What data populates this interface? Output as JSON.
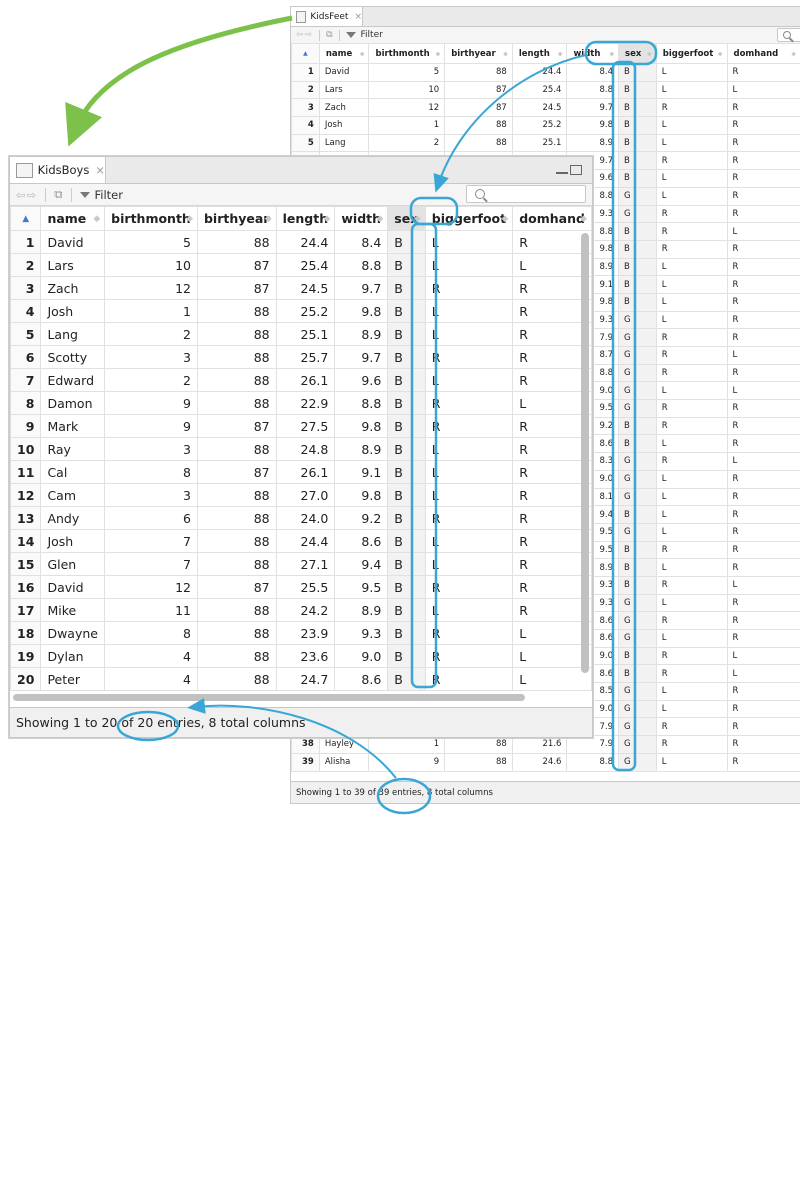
{
  "back_window": {
    "tab_title": "KidsFeet",
    "close_glyph": "×",
    "filter_label": "Filter",
    "columns": [
      "name",
      "birthmonth",
      "birthyear",
      "length",
      "width",
      "sex",
      "biggerfoot",
      "domhand"
    ],
    "rows": [
      [
        "1",
        "David",
        "5",
        "88",
        "24.4",
        "8.4",
        "B",
        "L",
        "R"
      ],
      [
        "2",
        "Lars",
        "10",
        "87",
        "25.4",
        "8.8",
        "B",
        "L",
        "L"
      ],
      [
        "3",
        "Zach",
        "12",
        "87",
        "24.5",
        "9.7",
        "B",
        "R",
        "R"
      ],
      [
        "4",
        "Josh",
        "1",
        "88",
        "25.2",
        "9.8",
        "B",
        "L",
        "R"
      ],
      [
        "5",
        "Lang",
        "2",
        "88",
        "25.1",
        "8.9",
        "B",
        "L",
        "R"
      ]
    ],
    "visible_right_rows": [
      [
        "9.7",
        "B",
        "R",
        "R"
      ],
      [
        "9.6",
        "B",
        "L",
        "R"
      ],
      [
        "8.8",
        "G",
        "L",
        "R"
      ],
      [
        "9.3",
        "G",
        "R",
        "R"
      ],
      [
        "8.8",
        "B",
        "R",
        "L"
      ],
      [
        "9.8",
        "B",
        "R",
        "R"
      ],
      [
        "8.9",
        "B",
        "L",
        "R"
      ],
      [
        "9.1",
        "B",
        "L",
        "R"
      ],
      [
        "9.8",
        "B",
        "L",
        "R"
      ],
      [
        "9.3",
        "G",
        "L",
        "R"
      ],
      [
        "7.9",
        "G",
        "R",
        "R"
      ],
      [
        "8.7",
        "G",
        "R",
        "L"
      ],
      [
        "8.8",
        "G",
        "R",
        "R"
      ],
      [
        "9.0",
        "G",
        "L",
        "L"
      ],
      [
        "9.5",
        "G",
        "R",
        "R"
      ],
      [
        "9.2",
        "B",
        "R",
        "R"
      ],
      [
        "8.6",
        "B",
        "L",
        "R"
      ],
      [
        "8.3",
        "G",
        "R",
        "L"
      ],
      [
        "9.0",
        "G",
        "L",
        "R"
      ],
      [
        "8.1",
        "G",
        "L",
        "R"
      ],
      [
        "9.4",
        "B",
        "L",
        "R"
      ],
      [
        "9.5",
        "G",
        "L",
        "R"
      ],
      [
        "9.5",
        "B",
        "R",
        "R"
      ],
      [
        "8.9",
        "B",
        "L",
        "R"
      ],
      [
        "9.3",
        "B",
        "R",
        "L"
      ],
      [
        "9.3",
        "G",
        "L",
        "R"
      ],
      [
        "8.6",
        "G",
        "R",
        "R"
      ],
      [
        "8.6",
        "G",
        "L",
        "R"
      ],
      [
        "9.0",
        "B",
        "R",
        "L"
      ],
      [
        "8.6",
        "B",
        "R",
        "L"
      ],
      [
        "8.5",
        "G",
        "L",
        "R"
      ],
      [
        "9.0",
        "G",
        "L",
        "R"
      ],
      [
        "7.9",
        "G",
        "R",
        "R"
      ]
    ],
    "partial_row_38": [
      "38",
      "Hayley",
      "1",
      "88",
      "21.6",
      "7.9",
      "G",
      "R",
      "R"
    ],
    "row_39": [
      "39",
      "Alisha",
      "9",
      "88",
      "24.6",
      "8.8",
      "G",
      "L",
      "R"
    ],
    "footer": "Showing 1 to 39 of 39 entries, 8 total columns"
  },
  "front_window": {
    "tab_title": "KidsBoys",
    "close_glyph": "×",
    "filter_label": "Filter",
    "columns": [
      "name",
      "birthmonth",
      "birthyear",
      "length",
      "width",
      "sex",
      "biggerfoot",
      "domhand"
    ],
    "rows": [
      [
        "1",
        "David",
        "5",
        "88",
        "24.4",
        "8.4",
        "B",
        "L",
        "R"
      ],
      [
        "2",
        "Lars",
        "10",
        "87",
        "25.4",
        "8.8",
        "B",
        "L",
        "L"
      ],
      [
        "3",
        "Zach",
        "12",
        "87",
        "24.5",
        "9.7",
        "B",
        "R",
        "R"
      ],
      [
        "4",
        "Josh",
        "1",
        "88",
        "25.2",
        "9.8",
        "B",
        "L",
        "R"
      ],
      [
        "5",
        "Lang",
        "2",
        "88",
        "25.1",
        "8.9",
        "B",
        "L",
        "R"
      ],
      [
        "6",
        "Scotty",
        "3",
        "88",
        "25.7",
        "9.7",
        "B",
        "R",
        "R"
      ],
      [
        "7",
        "Edward",
        "2",
        "88",
        "26.1",
        "9.6",
        "B",
        "L",
        "R"
      ],
      [
        "8",
        "Damon",
        "9",
        "88",
        "22.9",
        "8.8",
        "B",
        "R",
        "L"
      ],
      [
        "9",
        "Mark",
        "9",
        "87",
        "27.5",
        "9.8",
        "B",
        "R",
        "R"
      ],
      [
        "10",
        "Ray",
        "3",
        "88",
        "24.8",
        "8.9",
        "B",
        "L",
        "R"
      ],
      [
        "11",
        "Cal",
        "8",
        "87",
        "26.1",
        "9.1",
        "B",
        "L",
        "R"
      ],
      [
        "12",
        "Cam",
        "3",
        "88",
        "27.0",
        "9.8",
        "B",
        "L",
        "R"
      ],
      [
        "13",
        "Andy",
        "6",
        "88",
        "24.0",
        "9.2",
        "B",
        "R",
        "R"
      ],
      [
        "14",
        "Josh",
        "7",
        "88",
        "24.4",
        "8.6",
        "B",
        "L",
        "R"
      ],
      [
        "15",
        "Glen",
        "7",
        "88",
        "27.1",
        "9.4",
        "B",
        "L",
        "R"
      ],
      [
        "16",
        "David",
        "12",
        "87",
        "25.5",
        "9.5",
        "B",
        "R",
        "R"
      ],
      [
        "17",
        "Mike",
        "11",
        "88",
        "24.2",
        "8.9",
        "B",
        "L",
        "R"
      ],
      [
        "18",
        "Dwayne",
        "8",
        "88",
        "23.9",
        "9.3",
        "B",
        "R",
        "L"
      ],
      [
        "19",
        "Dylan",
        "4",
        "88",
        "23.6",
        "9.0",
        "B",
        "R",
        "L"
      ],
      [
        "20",
        "Peter",
        "4",
        "88",
        "24.7",
        "8.6",
        "B",
        "R",
        "L"
      ]
    ],
    "footer": "Showing 1 to 20 of 20 entries, 8 total columns"
  },
  "colors": {
    "highlight": "#3aa6d6",
    "arrow_green": "#7cc14a",
    "sort_blue": "#3a7ad0"
  }
}
